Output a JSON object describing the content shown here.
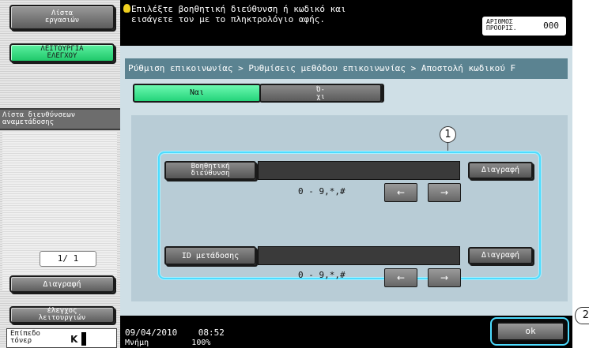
{
  "sidebar": {
    "job_list_label": "Λίστα\nεργασιών",
    "utility_label": "ΛΕΙΤΟΥΡΓΙΑ\nΕΛΕΓΧΟΥ",
    "list_title": "Λίστα διευθύνσεων\nαναμετάδοσης",
    "page_indicator": "1/ 1",
    "delete_label": "Διαγραφή",
    "check_label": "έλεγχος\nλειτουργιών",
    "toner_label": "Επίπεδο\nτόνερ",
    "toner_letter": "K"
  },
  "header": {
    "message": "Επιλέξτε βοηθητική διεύθυνση ή κωδικό και\nεισάγετε τον με το πληκτρολόγιο αφής.",
    "counter_label": "ΑΡΙΘΜΟΣ\nΠΡΟΟΡΙΣ.",
    "counter_value": "000"
  },
  "main": {
    "breadcrumb": "Ρύθμιση επικοινωνίας > Ρυθμίσεις μεθόδου επικοινωνίας > Αποστολή κωδικού F",
    "yes_label": "Ναι",
    "no_label": "Ό-\nχι",
    "callout_1": "1",
    "sub_address": {
      "label": "Βοηθητική\nδιεύθυνση",
      "value": "",
      "delete_label": "Διαγραφή",
      "range": "0 - 9,*,#",
      "left_arrow": "←",
      "right_arrow": "→"
    },
    "relay_id": {
      "label": "ID μετάδοσης",
      "value": "",
      "delete_label": "Διαγραφή",
      "range": "0 - 9,*,#",
      "left_arrow": "←",
      "right_arrow": "→"
    }
  },
  "footer": {
    "date": "09/04/2010",
    "time": "08:52",
    "memory_label": "Μνήμη",
    "memory_value": "100%",
    "ok_label": "ok",
    "callout_2": "2"
  },
  "colors": {
    "accent_green": "#24d47a",
    "highlight_cyan": "#4ddcff",
    "breadcrumb_bg": "#5b8391"
  }
}
